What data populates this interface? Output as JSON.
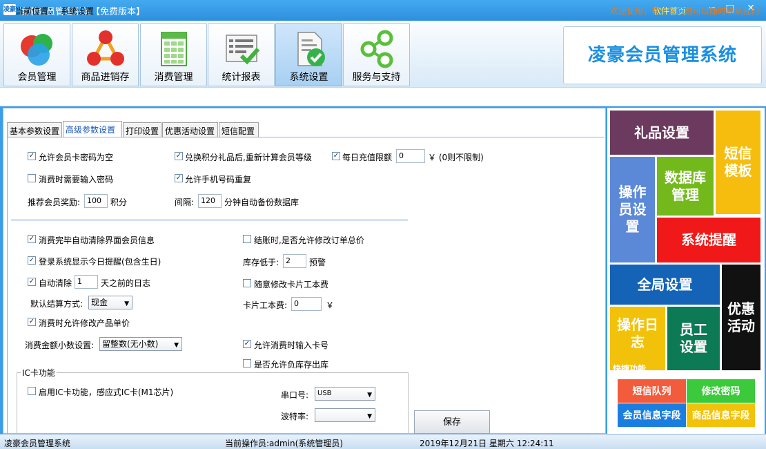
{
  "window": {
    "icon_text": "凌豪",
    "title": "凌豪会员管理系统【免费版本】",
    "home_link": "软件首页",
    "minimize": "─",
    "maximize": "□",
    "close": "✕"
  },
  "toolbar": {
    "tabs": [
      {
        "label": "会员管理",
        "icon": "members-icon"
      },
      {
        "label": "商品进销存",
        "icon": "inventory-icon"
      },
      {
        "label": "消费管理",
        "icon": "spreadsheet-icon"
      },
      {
        "label": "统计报表",
        "icon": "report-icon"
      },
      {
        "label": "系统设置",
        "icon": "settings-doc-icon",
        "active": true
      },
      {
        "label": "服务与支持",
        "icon": "share-icon"
      }
    ],
    "brand": "凌豪会员管理系统"
  },
  "location": {
    "label": "当前位置：",
    "value": "系统设置",
    "welcome": "欢迎使用，有什么问题可以随时联系我们"
  },
  "subtabs": [
    "基本参数设置",
    "高级参数设置",
    "打印设置",
    "优惠活动设置",
    "短信配置"
  ],
  "form": {
    "allow_empty_card_pwd": {
      "label": "允许会员卡密码为空",
      "checked": true
    },
    "recalc_level": {
      "label": "兑换积分礼品后,重新计算会员等级",
      "checked": true
    },
    "daily_topup_limit": {
      "label": "每日充值限额",
      "checked": true,
      "value": "0",
      "suffix": "￥ (0则不限制)"
    },
    "need_pwd_on_consume": {
      "label": "消费时需要输入密码",
      "checked": false
    },
    "allow_dup_phone": {
      "label": "允许手机号码重复",
      "checked": true
    },
    "referral_reward": {
      "label": "推荐会员奖励:",
      "value": "100",
      "suffix": "积分"
    },
    "backup_interval": {
      "label": "间隔:",
      "value": "120",
      "suffix": "分钟自动备份数据库"
    },
    "auto_clear_after_consume": {
      "label": "消费完毕自动清除界面会员信息",
      "checked": true
    },
    "allow_edit_total": {
      "label": "结账时,是否允许修改订单总价",
      "checked": false
    },
    "login_today_reminder": {
      "label": "登录系统显示今日提醒(包含生日)",
      "checked": true
    },
    "stock_low": {
      "label": "库存低于:",
      "value": "2",
      "suffix": "预警"
    },
    "auto_clear_logs": {
      "label": "自动清除",
      "checked": true,
      "value": "1",
      "suffix": "天之前的日志"
    },
    "edit_card_fee": {
      "label": "随意修改卡片工本费",
      "checked": false
    },
    "default_payment": {
      "label": "默认结算方式:",
      "value": "现金"
    },
    "card_fee": {
      "label": "卡片工本费:",
      "value": "0",
      "suffix": "￥"
    },
    "allow_edit_unit_price": {
      "label": "消费时允许修改产品单价",
      "checked": true
    },
    "decimal_setting": {
      "label": "消费金额小数设置:",
      "value": "留整数(无小数)"
    },
    "allow_card_input": {
      "label": "允许消费时输入卡号",
      "checked": true
    },
    "allow_negative_stock": {
      "label": "是否允许负库存出库",
      "checked": false
    },
    "ic_group": {
      "title": "IC卡功能"
    },
    "enable_ic": {
      "label": "启用IC卡功能，感应式IC卡(M1芯片)",
      "checked": false
    },
    "serial_port": {
      "label": "串口号:",
      "value": "USB"
    },
    "baud_rate": {
      "label": "波特率:",
      "value": ""
    },
    "save_label": "保存",
    "check_mark": "✓",
    "dropdown_arrow": "▼"
  },
  "tiles": {
    "gift": "礼品设置",
    "sms_template": "短信模板",
    "operator": "操作员设置",
    "database": "数据库管理",
    "reminder": "系统提醒",
    "global": "全局设置",
    "promotion": "优惠活动",
    "op_log": "操作日志",
    "quick": "快捷功能",
    "staff": "员工设置",
    "sms_queue": "短信队列",
    "change_pwd": "修改密码",
    "member_fields": "会员信息字段",
    "product_fields": "商品信息字段"
  },
  "colors": {
    "gift": "#6b3a5e",
    "sms_template": "#f6bd0f",
    "operator": "#5b89d8",
    "database": "#73b91c",
    "reminder": "#f01818",
    "global": "#1463b7",
    "promotion": "#111111",
    "op_log": "#f2c10a",
    "staff": "#0b7a55",
    "sms_queue": "#f25c3c",
    "change_pwd": "#3cc93c",
    "member_fields": "#1a7ee0",
    "product_fields": "#f2c10a"
  },
  "status": {
    "app": "凌豪会员管理系统",
    "operator": "当前操作员:admin(系统管理员)",
    "datetime": "2019年12月21日 星期六 12:24:11"
  }
}
